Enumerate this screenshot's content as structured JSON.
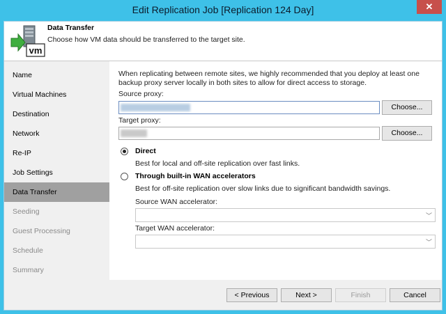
{
  "window": {
    "title": "Edit Replication Job [Replication 124 Day]",
    "close_glyph": "✕"
  },
  "header": {
    "title": "Data Transfer",
    "description": "Choose how VM data should be transferred to the target site.",
    "icon": "vm-transfer-icon",
    "icon_text": "vm"
  },
  "sidebar": {
    "items": [
      {
        "label": "Name",
        "state": "normal"
      },
      {
        "label": "Virtual Machines",
        "state": "normal"
      },
      {
        "label": "Destination",
        "state": "normal"
      },
      {
        "label": "Network",
        "state": "normal"
      },
      {
        "label": "Re-IP",
        "state": "normal"
      },
      {
        "label": "Job Settings",
        "state": "normal"
      },
      {
        "label": "Data Transfer",
        "state": "active"
      },
      {
        "label": "Seeding",
        "state": "disabled"
      },
      {
        "label": "Guest Processing",
        "state": "disabled"
      },
      {
        "label": "Schedule",
        "state": "disabled"
      },
      {
        "label": "Summary",
        "state": "disabled"
      }
    ]
  },
  "content": {
    "info": "When replicating between remote sites, we highly recommended that you deploy at least one backup proxy server locally in both sites to allow for direct access to storage.",
    "source_proxy": {
      "label": "Source proxy:",
      "button": "Choose..."
    },
    "target_proxy": {
      "label": "Target proxy:",
      "button": "Choose..."
    },
    "direct": {
      "label": "Direct",
      "description": "Best for local and off-site replication over fast links.",
      "checked": true
    },
    "wan": {
      "label": "Through built-in WAN accelerators",
      "description": "Best for off-site replication over slow links due to significant bandwidth savings.",
      "checked": false
    },
    "source_wan": {
      "label": "Source WAN accelerator:",
      "value": ""
    },
    "target_wan": {
      "label": "Target WAN accelerator:",
      "value": ""
    }
  },
  "footer": {
    "previous": "< Previous",
    "next": "Next >",
    "finish": "Finish",
    "cancel": "Cancel"
  },
  "colors": {
    "title_bar": "#3ec1e8",
    "close_button": "#c7504b",
    "sidebar_active": "#a0a0a0"
  }
}
